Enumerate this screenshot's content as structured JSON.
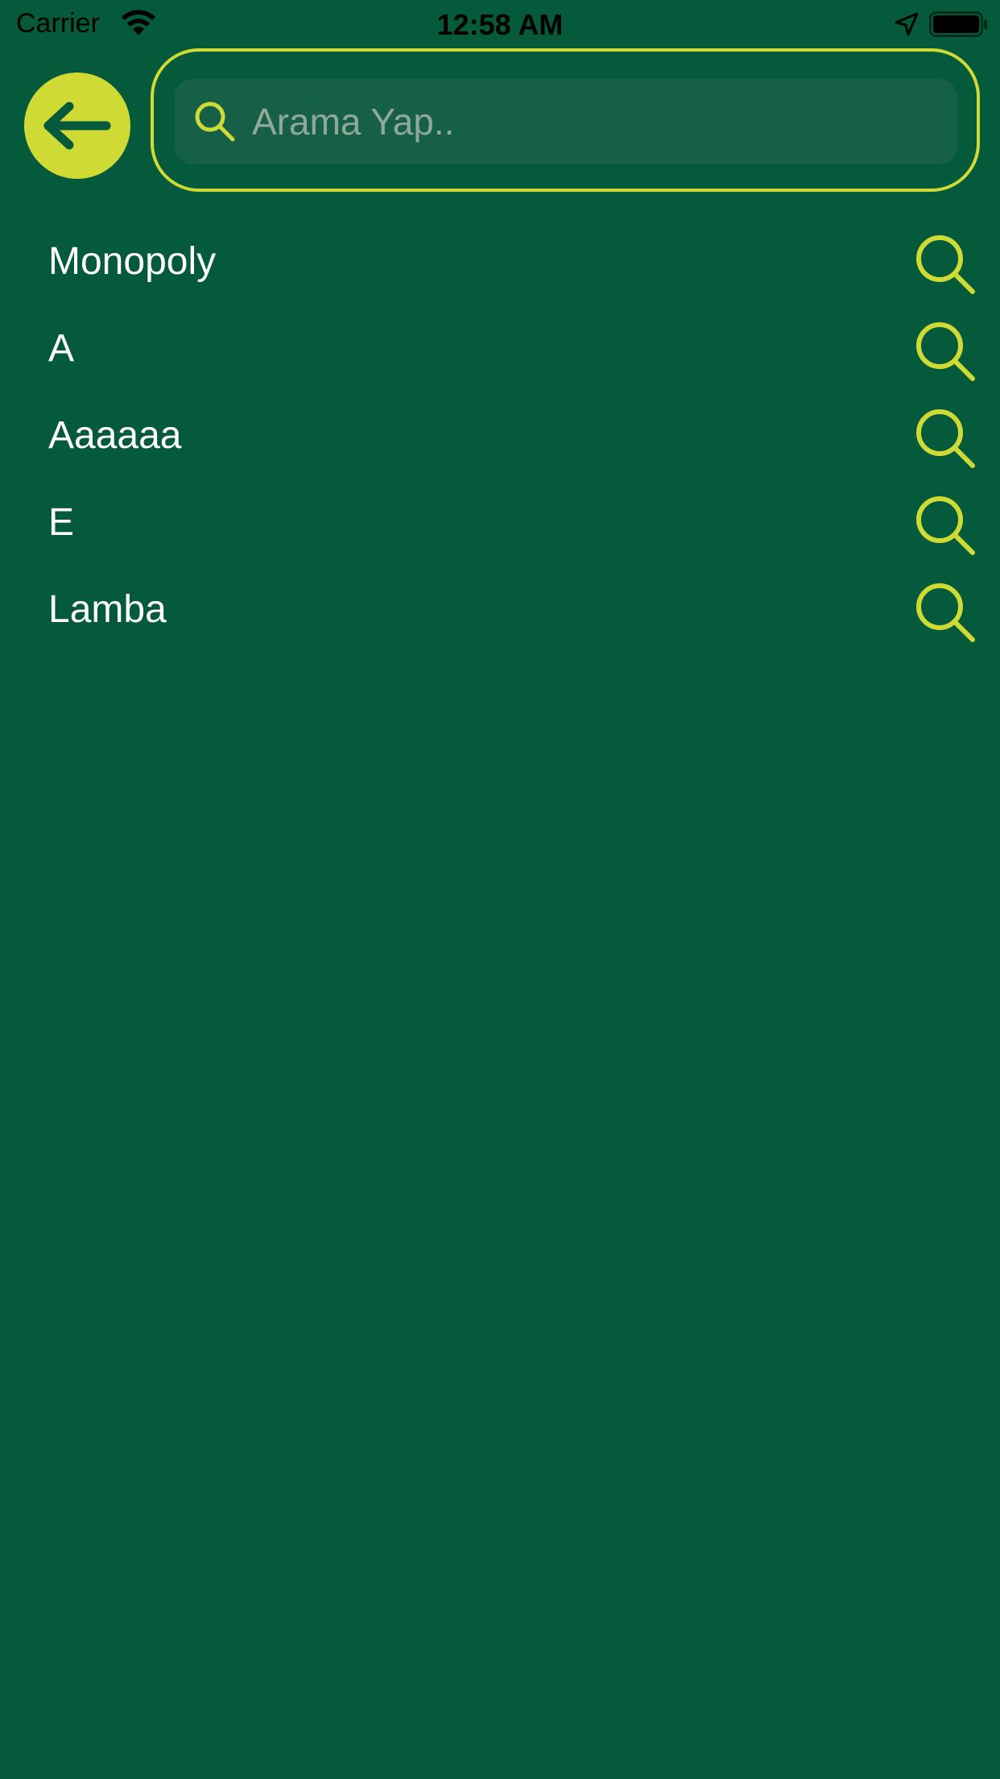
{
  "status_bar": {
    "carrier": "Carrier",
    "time": "12:58 AM",
    "icons": [
      "wifi-icon",
      "location-arrow-icon",
      "battery-icon"
    ]
  },
  "header": {
    "back_icon": "arrow-left-icon",
    "search": {
      "placeholder": "Arama Yap..",
      "value": "",
      "icon": "search-icon"
    }
  },
  "results": {
    "items": [
      {
        "label": "Monopoly",
        "icon": "search-icon"
      },
      {
        "label": "A",
        "icon": "search-icon"
      },
      {
        "label": "Aaaaaa",
        "icon": "search-icon"
      },
      {
        "label": "E",
        "icon": "search-icon"
      },
      {
        "label": "Lamba",
        "icon": "search-icon"
      }
    ]
  },
  "colors": {
    "background": "#055a3c",
    "accent": "#cfda35",
    "search_field_bg": "#156046",
    "text": "#ffffff"
  }
}
